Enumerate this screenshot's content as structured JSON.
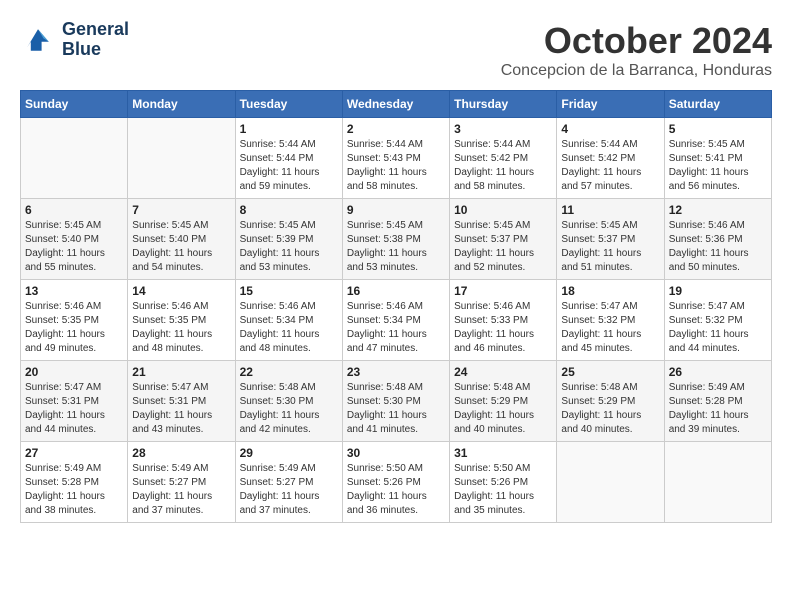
{
  "logo": {
    "line1": "General",
    "line2": "Blue"
  },
  "title": "October 2024",
  "location": "Concepcion de la Barranca, Honduras",
  "weekdays": [
    "Sunday",
    "Monday",
    "Tuesday",
    "Wednesday",
    "Thursday",
    "Friday",
    "Saturday"
  ],
  "weeks": [
    [
      {
        "day": "",
        "sunrise": "",
        "sunset": "",
        "daylight": ""
      },
      {
        "day": "",
        "sunrise": "",
        "sunset": "",
        "daylight": ""
      },
      {
        "day": "1",
        "sunrise": "Sunrise: 5:44 AM",
        "sunset": "Sunset: 5:44 PM",
        "daylight": "Daylight: 11 hours and 59 minutes."
      },
      {
        "day": "2",
        "sunrise": "Sunrise: 5:44 AM",
        "sunset": "Sunset: 5:43 PM",
        "daylight": "Daylight: 11 hours and 58 minutes."
      },
      {
        "day": "3",
        "sunrise": "Sunrise: 5:44 AM",
        "sunset": "Sunset: 5:42 PM",
        "daylight": "Daylight: 11 hours and 58 minutes."
      },
      {
        "day": "4",
        "sunrise": "Sunrise: 5:44 AM",
        "sunset": "Sunset: 5:42 PM",
        "daylight": "Daylight: 11 hours and 57 minutes."
      },
      {
        "day": "5",
        "sunrise": "Sunrise: 5:45 AM",
        "sunset": "Sunset: 5:41 PM",
        "daylight": "Daylight: 11 hours and 56 minutes."
      }
    ],
    [
      {
        "day": "6",
        "sunrise": "Sunrise: 5:45 AM",
        "sunset": "Sunset: 5:40 PM",
        "daylight": "Daylight: 11 hours and 55 minutes."
      },
      {
        "day": "7",
        "sunrise": "Sunrise: 5:45 AM",
        "sunset": "Sunset: 5:40 PM",
        "daylight": "Daylight: 11 hours and 54 minutes."
      },
      {
        "day": "8",
        "sunrise": "Sunrise: 5:45 AM",
        "sunset": "Sunset: 5:39 PM",
        "daylight": "Daylight: 11 hours and 53 minutes."
      },
      {
        "day": "9",
        "sunrise": "Sunrise: 5:45 AM",
        "sunset": "Sunset: 5:38 PM",
        "daylight": "Daylight: 11 hours and 53 minutes."
      },
      {
        "day": "10",
        "sunrise": "Sunrise: 5:45 AM",
        "sunset": "Sunset: 5:37 PM",
        "daylight": "Daylight: 11 hours and 52 minutes."
      },
      {
        "day": "11",
        "sunrise": "Sunrise: 5:45 AM",
        "sunset": "Sunset: 5:37 PM",
        "daylight": "Daylight: 11 hours and 51 minutes."
      },
      {
        "day": "12",
        "sunrise": "Sunrise: 5:46 AM",
        "sunset": "Sunset: 5:36 PM",
        "daylight": "Daylight: 11 hours and 50 minutes."
      }
    ],
    [
      {
        "day": "13",
        "sunrise": "Sunrise: 5:46 AM",
        "sunset": "Sunset: 5:35 PM",
        "daylight": "Daylight: 11 hours and 49 minutes."
      },
      {
        "day": "14",
        "sunrise": "Sunrise: 5:46 AM",
        "sunset": "Sunset: 5:35 PM",
        "daylight": "Daylight: 11 hours and 48 minutes."
      },
      {
        "day": "15",
        "sunrise": "Sunrise: 5:46 AM",
        "sunset": "Sunset: 5:34 PM",
        "daylight": "Daylight: 11 hours and 48 minutes."
      },
      {
        "day": "16",
        "sunrise": "Sunrise: 5:46 AM",
        "sunset": "Sunset: 5:34 PM",
        "daylight": "Daylight: 11 hours and 47 minutes."
      },
      {
        "day": "17",
        "sunrise": "Sunrise: 5:46 AM",
        "sunset": "Sunset: 5:33 PM",
        "daylight": "Daylight: 11 hours and 46 minutes."
      },
      {
        "day": "18",
        "sunrise": "Sunrise: 5:47 AM",
        "sunset": "Sunset: 5:32 PM",
        "daylight": "Daylight: 11 hours and 45 minutes."
      },
      {
        "day": "19",
        "sunrise": "Sunrise: 5:47 AM",
        "sunset": "Sunset: 5:32 PM",
        "daylight": "Daylight: 11 hours and 44 minutes."
      }
    ],
    [
      {
        "day": "20",
        "sunrise": "Sunrise: 5:47 AM",
        "sunset": "Sunset: 5:31 PM",
        "daylight": "Daylight: 11 hours and 44 minutes."
      },
      {
        "day": "21",
        "sunrise": "Sunrise: 5:47 AM",
        "sunset": "Sunset: 5:31 PM",
        "daylight": "Daylight: 11 hours and 43 minutes."
      },
      {
        "day": "22",
        "sunrise": "Sunrise: 5:48 AM",
        "sunset": "Sunset: 5:30 PM",
        "daylight": "Daylight: 11 hours and 42 minutes."
      },
      {
        "day": "23",
        "sunrise": "Sunrise: 5:48 AM",
        "sunset": "Sunset: 5:30 PM",
        "daylight": "Daylight: 11 hours and 41 minutes."
      },
      {
        "day": "24",
        "sunrise": "Sunrise: 5:48 AM",
        "sunset": "Sunset: 5:29 PM",
        "daylight": "Daylight: 11 hours and 40 minutes."
      },
      {
        "day": "25",
        "sunrise": "Sunrise: 5:48 AM",
        "sunset": "Sunset: 5:29 PM",
        "daylight": "Daylight: 11 hours and 40 minutes."
      },
      {
        "day": "26",
        "sunrise": "Sunrise: 5:49 AM",
        "sunset": "Sunset: 5:28 PM",
        "daylight": "Daylight: 11 hours and 39 minutes."
      }
    ],
    [
      {
        "day": "27",
        "sunrise": "Sunrise: 5:49 AM",
        "sunset": "Sunset: 5:28 PM",
        "daylight": "Daylight: 11 hours and 38 minutes."
      },
      {
        "day": "28",
        "sunrise": "Sunrise: 5:49 AM",
        "sunset": "Sunset: 5:27 PM",
        "daylight": "Daylight: 11 hours and 37 minutes."
      },
      {
        "day": "29",
        "sunrise": "Sunrise: 5:49 AM",
        "sunset": "Sunset: 5:27 PM",
        "daylight": "Daylight: 11 hours and 37 minutes."
      },
      {
        "day": "30",
        "sunrise": "Sunrise: 5:50 AM",
        "sunset": "Sunset: 5:26 PM",
        "daylight": "Daylight: 11 hours and 36 minutes."
      },
      {
        "day": "31",
        "sunrise": "Sunrise: 5:50 AM",
        "sunset": "Sunset: 5:26 PM",
        "daylight": "Daylight: 11 hours and 35 minutes."
      },
      {
        "day": "",
        "sunrise": "",
        "sunset": "",
        "daylight": ""
      },
      {
        "day": "",
        "sunrise": "",
        "sunset": "",
        "daylight": ""
      }
    ]
  ]
}
